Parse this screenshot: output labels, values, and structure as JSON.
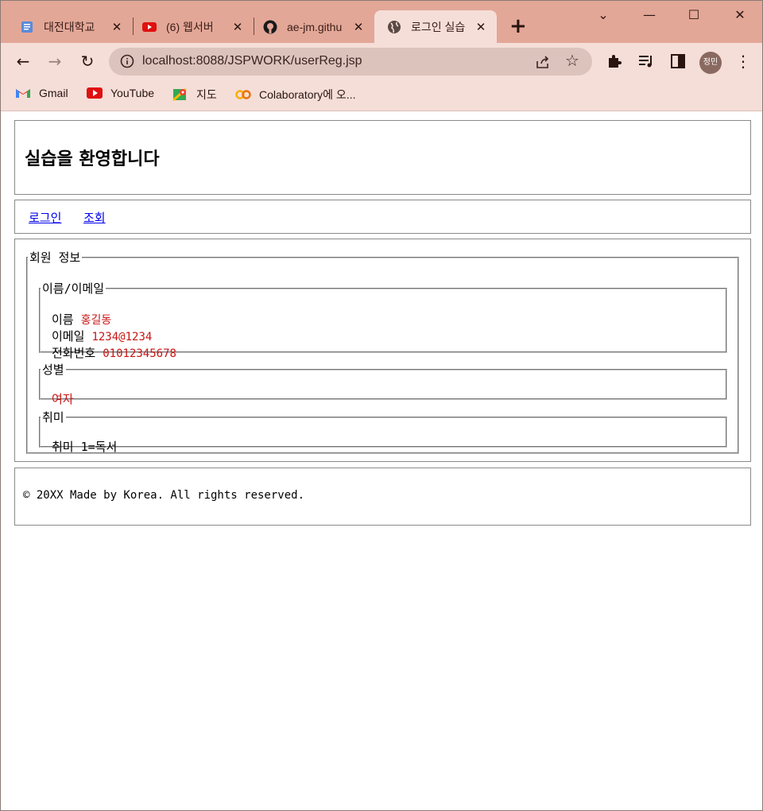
{
  "browser": {
    "tabs": [
      {
        "title": "대전대학교",
        "active": false
      },
      {
        "title": "(6) 웹서버",
        "active": false
      },
      {
        "title": "ae-jm.githu",
        "active": false
      },
      {
        "title": "로그인 실습",
        "active": true
      }
    ],
    "new_tab": "+",
    "url": "localhost:8088/JSPWORK/userReg.jsp",
    "profile_initials": "정민",
    "bookmarks": [
      {
        "label": "Gmail",
        "icon": "gmail-icon"
      },
      {
        "label": "YouTube",
        "icon": "youtube-icon"
      },
      {
        "label": "지도",
        "icon": "maps-icon"
      },
      {
        "label": "Colaboratory에 오...",
        "icon": "colab-icon"
      }
    ],
    "colors": {
      "tab_strip": "#e3a797",
      "toolbar": "#f5ded8",
      "omnibox": "#dcc4bd"
    }
  },
  "page": {
    "header_title": "실습을 환영합니다",
    "nav": {
      "login": "로그인",
      "lookup": "조회"
    },
    "member_info": {
      "legend": "회원 정보",
      "name_email": {
        "legend": "이름/이메일",
        "name_label": "이름",
        "name_value": "홍길동",
        "email_label": "이메일",
        "email_value": "1234@1234",
        "phone_label": "전화번호",
        "phone_value": "01012345678"
      },
      "gender": {
        "legend": "성별",
        "value": "여자"
      },
      "hobby": {
        "legend": "취미",
        "text": "취미 1=독서"
      }
    },
    "footer": "© 20XX Made by Korea. All rights reserved.",
    "value_color": "#c81414",
    "link_color": "#0000ee"
  }
}
